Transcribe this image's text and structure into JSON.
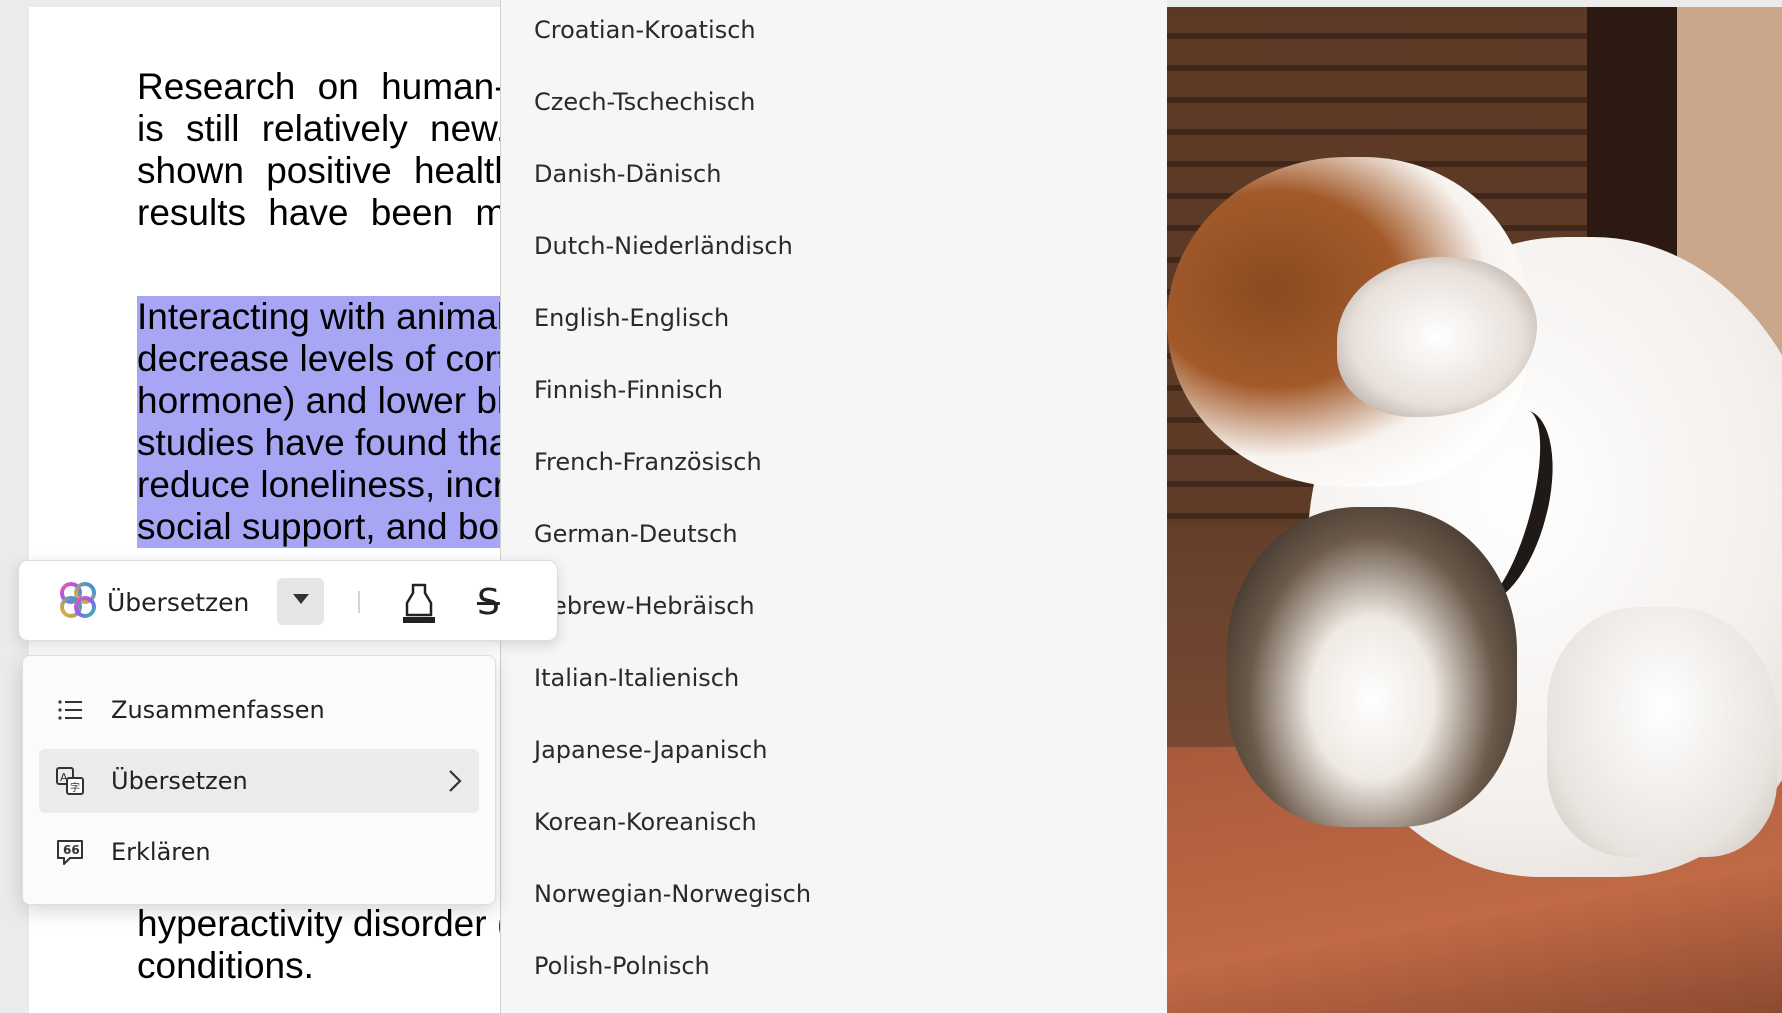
{
  "document": {
    "paragraph1": [
      "Research on human-animal interaction",
      "is still relatively new. Some studies have",
      "shown positive health effects, but the",
      "results have been mixed."
    ],
    "paragraph2": [
      "Interacting with animals has been shown to",
      "decrease levels of cortisol (a stress-related",
      "hormone) and lower blood pressure. Other",
      "studies have found that animals can",
      "reduce loneliness,  increase feelings of",
      "social support, and boost your mood."
    ],
    "paragraph3": [
      "hyperactivity disorder (ADHD) and other",
      "conditions."
    ]
  },
  "toolbar": {
    "translate_label": "Übersetzen",
    "icons": [
      "copilot-icon",
      "chevron-down-icon",
      "highlighter-icon",
      "strikethrough-icon"
    ]
  },
  "context_menu": {
    "items": [
      {
        "label": "Zusammenfassen",
        "icon": "list-icon"
      },
      {
        "label": "Übersetzen",
        "icon": "translate-icon",
        "has_submenu": true,
        "selected": true
      },
      {
        "label": "Erklären",
        "icon": "explain-icon"
      }
    ]
  },
  "language_list": {
    "items": [
      "Croatian-Kroatisch",
      "Czech-Tschechisch",
      "Danish-Dänisch",
      "Dutch-Niederländisch",
      "English-Englisch",
      "Finnish-Finnisch",
      "French-Französisch",
      "German-Deutsch",
      "Hebrew-Hebräisch",
      "Italian-Italienisch",
      "Japanese-Japanisch",
      "Korean-Koreanisch",
      "Norwegian-Norwegisch",
      "Polish-Polnisch"
    ]
  },
  "colors": {
    "selection": "#a6a6f4",
    "panel_background": "#f6f6f6",
    "menu_hover": "#ebebeb"
  }
}
